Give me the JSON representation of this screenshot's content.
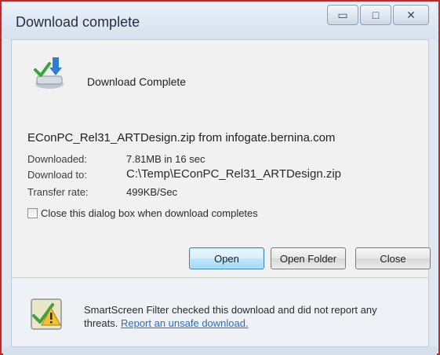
{
  "window": {
    "title": "Download complete",
    "controls": {
      "minimize_glyph": "▭",
      "maximize_glyph": "□",
      "close_glyph": "✕"
    }
  },
  "header": {
    "heading": "Download Complete",
    "icon": "download-complete-icon"
  },
  "file": {
    "source_line": "EConPC_Rel31_ARTDesign.zip from infogate.bernina.com"
  },
  "details": {
    "downloaded_label": "Downloaded:",
    "downloaded_value": "7.81MB in 16 sec",
    "download_to_label": "Download to:",
    "download_to_value": "C:\\Temp\\EConPC_Rel31_ARTDesign.zip",
    "transfer_rate_label": "Transfer rate:",
    "transfer_rate_value": "499KB/Sec"
  },
  "options": {
    "close_when_complete_label": "Close this dialog box when download completes",
    "close_when_complete_checked": false
  },
  "buttons": {
    "open": "Open",
    "open_folder": "Open Folder",
    "close": "Close"
  },
  "footer": {
    "icon": "smartscreen-shield-icon",
    "message": "SmartScreen Filter checked this download and did not report any threats. ",
    "link": "Report an unsafe download."
  },
  "colors": {
    "frame_border": "#c8252a",
    "link": "#2b6cc7",
    "default_button": "#a7d9f5"
  }
}
